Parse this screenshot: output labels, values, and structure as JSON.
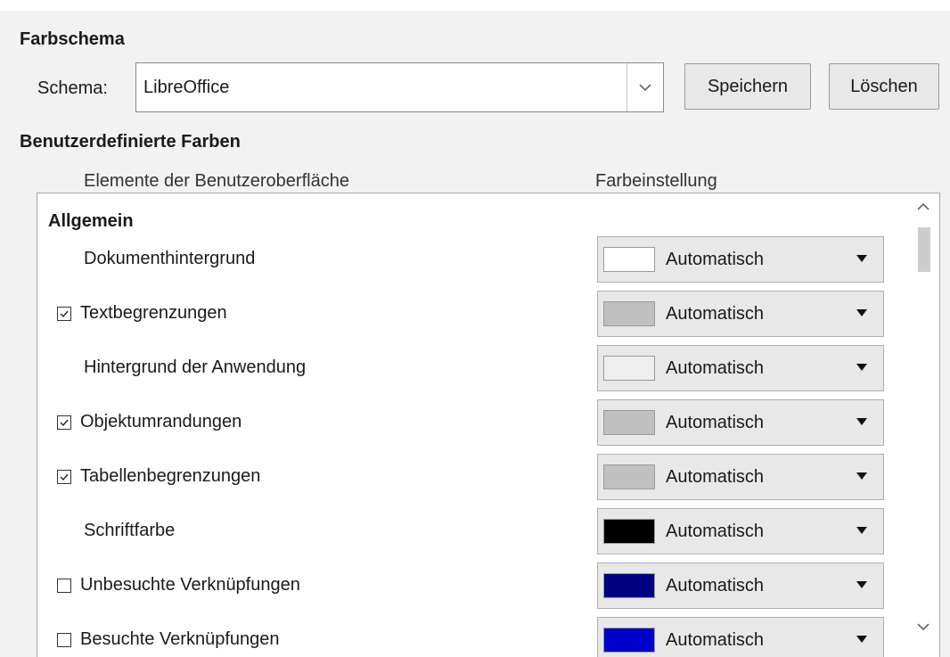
{
  "section_scheme": {
    "title": "Farbschema"
  },
  "schema": {
    "label": "Schema:",
    "value": "LibreOffice",
    "save_label": "Speichern",
    "delete_label": "Löschen"
  },
  "section_custom": {
    "title": "Benutzerdefinierte Farben"
  },
  "columns": {
    "ui_elements": "Elemente der Benutzeroberfläche",
    "color_setting": "Farbeinstellung"
  },
  "group": {
    "title": "Allgemein"
  },
  "rows": [
    {
      "label": "Dokumenthintergrund",
      "checkbox": null,
      "color_label": "Automatisch",
      "swatch": "#ffffff"
    },
    {
      "label": "Textbegrenzungen",
      "checkbox": true,
      "color_label": "Automatisch",
      "swatch": "#c0c0c0"
    },
    {
      "label": "Hintergrund der Anwendung",
      "checkbox": null,
      "color_label": "Automatisch",
      "swatch": "#eeeeee"
    },
    {
      "label": "Objektumrandungen",
      "checkbox": true,
      "color_label": "Automatisch",
      "swatch": "#c0c0c0"
    },
    {
      "label": "Tabellenbegrenzungen",
      "checkbox": true,
      "color_label": "Automatisch",
      "swatch": "#c0c0c0"
    },
    {
      "label": "Schriftfarbe",
      "checkbox": null,
      "color_label": "Automatisch",
      "swatch": "#000000"
    },
    {
      "label": "Unbesuchte Verknüpfungen",
      "checkbox": false,
      "color_label": "Automatisch",
      "swatch": "#000080"
    },
    {
      "label": "Besuchte Verknüpfungen",
      "checkbox": false,
      "color_label": "Automatisch",
      "swatch": "#0000cc"
    }
  ],
  "icons": {
    "combo": "chevron-down-icon",
    "checkbox_mark": "checkmark-icon",
    "dropdown": "triangle-down-icon",
    "scroll_up": "chevron-up-icon",
    "scroll_down": "chevron-down-icon"
  }
}
